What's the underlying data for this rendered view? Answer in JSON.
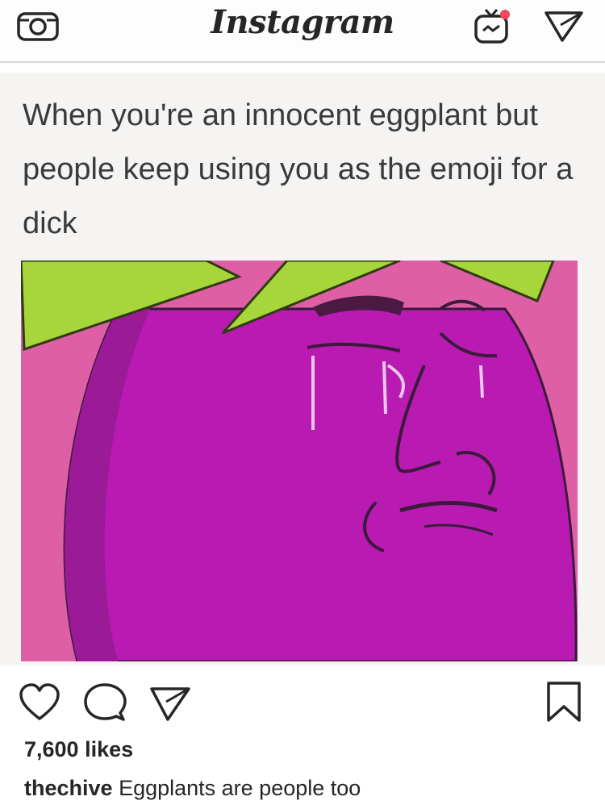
{
  "header": {
    "logo_text": "Instagram",
    "icons": [
      "camera-icon",
      "igtv-icon",
      "direct-message-icon"
    ],
    "notification_dot_color": "#ed4956"
  },
  "post": {
    "image_text": "When you're an innocent eggplant but people keep using you as the emoji for a dick",
    "image_colors": {
      "background": "#de5fa6",
      "eggplant": "#b91bb2",
      "leaf": "#a6d63a"
    },
    "action_icons": [
      "heart-icon",
      "comment-icon",
      "share-icon",
      "bookmark-icon"
    ],
    "likes": "7,600 likes",
    "caption_user": "thechive",
    "caption_text": "Eggplants are people too"
  }
}
